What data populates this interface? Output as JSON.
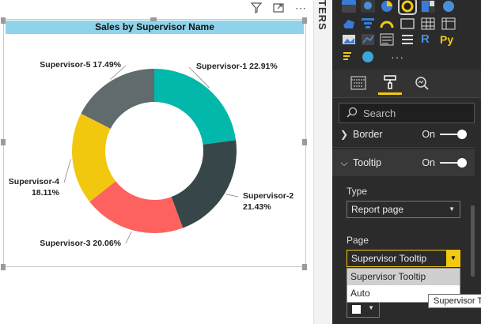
{
  "visual": {
    "title": "Sales by Supervisor Name",
    "header_icons": [
      "filter-icon",
      "focus-mode-icon",
      "more-options-icon"
    ],
    "more_glyph": "⋯"
  },
  "chart_data": {
    "type": "pie",
    "variant": "donut",
    "title": "Sales by Supervisor Name",
    "labels": [
      "Supervisor-1",
      "Supervisor-2",
      "Supervisor-3",
      "Supervisor-4",
      "Supervisor-5"
    ],
    "values": [
      22.91,
      21.43,
      20.06,
      18.11,
      17.49
    ],
    "value_labels": [
      "22.91%",
      "21.43%",
      "20.06%",
      "18.11%",
      "17.49%"
    ],
    "colors": [
      "#01b8aa",
      "#374649",
      "#fd625e",
      "#f2c80f",
      "#5f6b6d"
    ],
    "legend": "none"
  },
  "filters_strip": {
    "label": "TERS"
  },
  "pane": {
    "viz_more": "···",
    "format_tab_icons": [
      "fields-icon",
      "format-paint-roller-icon",
      "analytics-icon"
    ],
    "search": {
      "placeholder": "Search",
      "value": ""
    },
    "border_section": {
      "label": "Border",
      "toggle_label": "On"
    },
    "tooltip_section": {
      "label": "Tooltip",
      "toggle_label": "On"
    },
    "type": {
      "label": "Type",
      "value": "Report page"
    },
    "page": {
      "label": "Page",
      "value": "Supervisor Tooltip",
      "options": [
        "Supervisor Tooltip",
        "Auto"
      ]
    },
    "hover_tooltip": "Supervisor Tooltip"
  }
}
